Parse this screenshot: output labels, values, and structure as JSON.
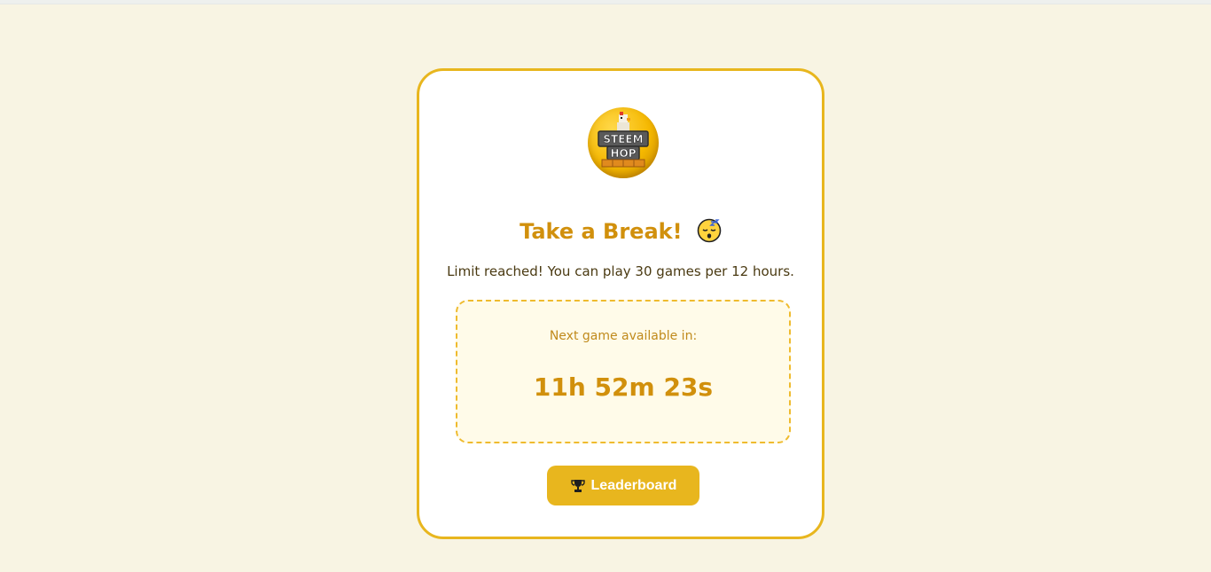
{
  "card": {
    "logo": {
      "line1": "STEEM",
      "line2": "HOP"
    },
    "title": "Take a Break!",
    "title_emoji": "sleeping-face-icon",
    "subtitle": "Limit reached! You can play 30 games per 12 hours.",
    "timer": {
      "label": "Next game available in:",
      "value": "11h 52m 23s"
    },
    "leaderboard_button": {
      "label": "Leaderboard",
      "icon": "trophy-icon"
    }
  },
  "colors": {
    "page_background": "#f8f4e3",
    "accent": "#e8b61e",
    "title": "#d1900c",
    "timer_box_background": "#fffbe9"
  }
}
